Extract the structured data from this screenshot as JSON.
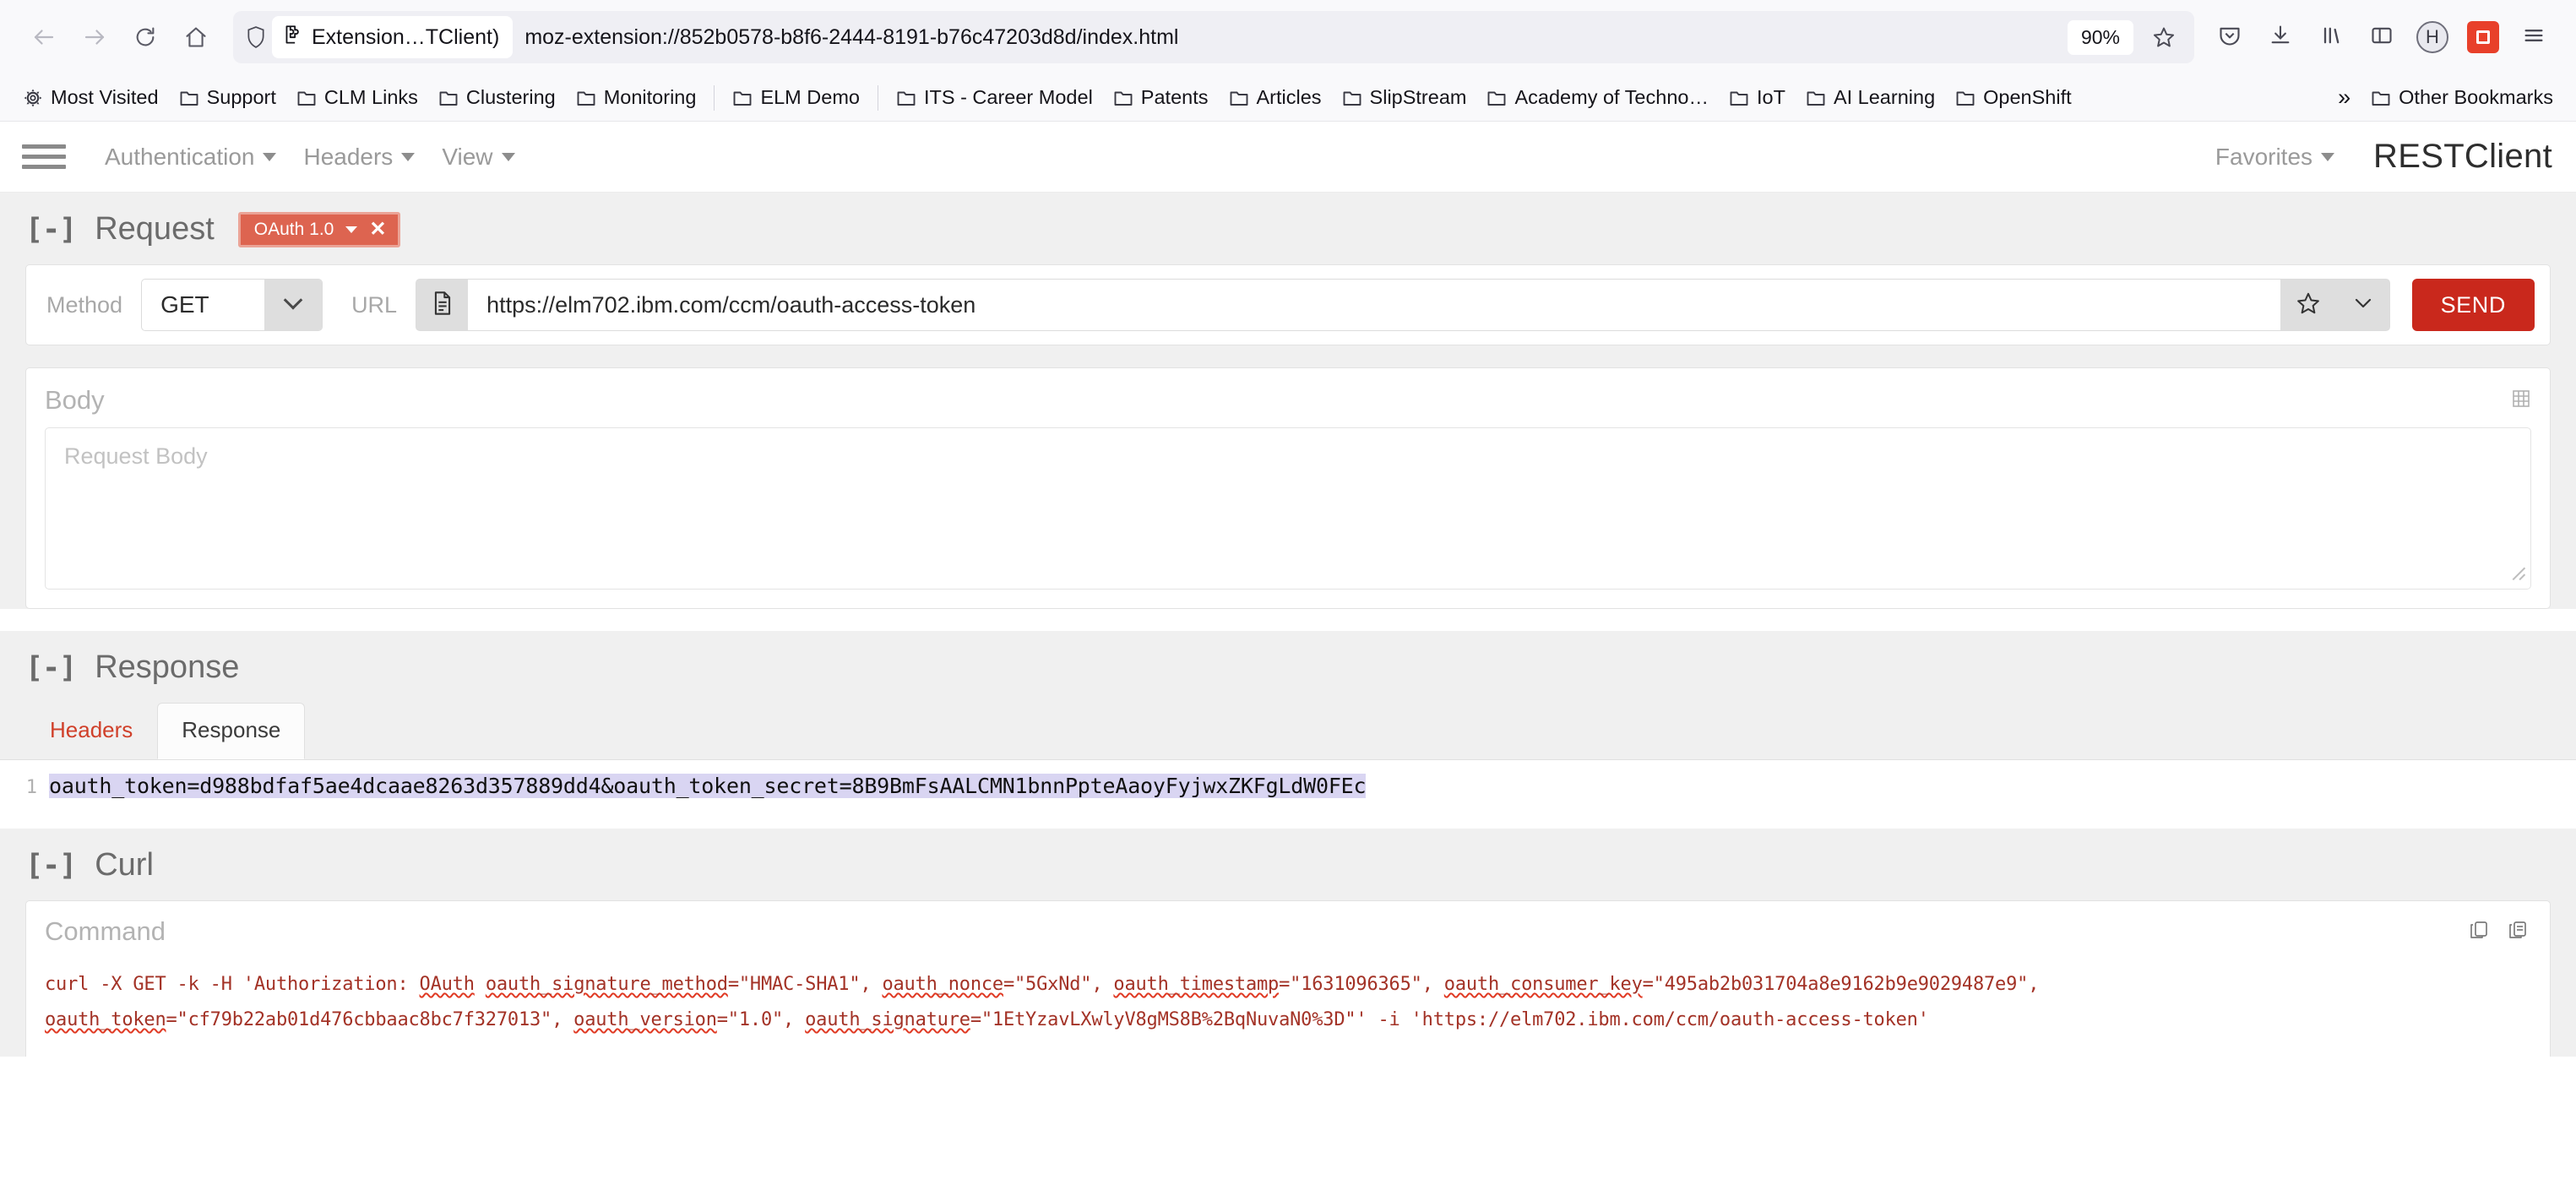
{
  "browser": {
    "nav": {
      "back": "back-arrow",
      "forward": "forward-arrow",
      "reload": "reload",
      "home": "home"
    },
    "urlbar": {
      "shield_icon": "shield-icon",
      "extension_chip_label": "Extension…TClient)",
      "url": "moz-extension://852b0578-b8f6-2444-8191-b76c47203d8d/index.html",
      "zoom": "90%",
      "bookmark_star": "star-icon"
    },
    "toolbar_right": [
      "pocket-icon",
      "downloads-icon",
      "library-icon",
      "sidebar-icon",
      "account-icon",
      "restclient-extension-icon",
      "app-menu-icon"
    ],
    "bookmarks": [
      {
        "label": "Most Visited",
        "icon": "gear-icon"
      },
      {
        "label": "Support",
        "icon": "folder-icon"
      },
      {
        "label": "CLM Links",
        "icon": "folder-icon"
      },
      {
        "label": "Clustering",
        "icon": "folder-icon"
      },
      {
        "label": "Monitoring",
        "icon": "folder-icon"
      },
      {
        "label": "ELM Demo",
        "icon": "folder-icon"
      },
      {
        "label": "ITS - Career Model",
        "icon": "folder-icon"
      },
      {
        "label": "Patents",
        "icon": "folder-icon"
      },
      {
        "label": "Articles",
        "icon": "folder-icon"
      },
      {
        "label": "SlipStream",
        "icon": "folder-icon"
      },
      {
        "label": "Academy of Techno…",
        "icon": "folder-icon"
      },
      {
        "label": "IoT",
        "icon": "folder-icon"
      },
      {
        "label": "AI Learning",
        "icon": "folder-icon"
      },
      {
        "label": "OpenShift",
        "icon": "folder-icon"
      }
    ],
    "bookmarks_overflow": "»",
    "other_bookmarks": "Other Bookmarks"
  },
  "app": {
    "menu": [
      {
        "label": "Authentication"
      },
      {
        "label": "Headers"
      },
      {
        "label": "View"
      }
    ],
    "favorites_label": "Favorites",
    "brand": "RESTClient"
  },
  "request": {
    "toggle": "[-]",
    "title": "Request",
    "auth_badge": {
      "label": "OAuth 1.0",
      "close": "✕"
    },
    "method_label": "Method",
    "method_value": "GET",
    "url_label": "URL",
    "url_value": "https://elm702.ibm.com/ccm/oauth-access-token",
    "send_label": "SEND",
    "body_label": "Body",
    "body_placeholder": "Request Body"
  },
  "response": {
    "toggle": "[-]",
    "title": "Response",
    "tabs": [
      {
        "label": "Headers",
        "active": false
      },
      {
        "label": "Response",
        "active": true
      }
    ],
    "line_number": "1",
    "content": "oauth_token=d988bdfaf5ae4dcaae8263d357889dd4&oauth_token_secret=8B9BmFsAALCMN1bnnPpteAaoyFyjwxZKFgLdW0FEc"
  },
  "curl": {
    "toggle": "[-]",
    "title": "Curl",
    "command_label": "Command",
    "command": "curl -X GET -k -H 'Authorization: OAuth oauth_signature_method=\"HMAC-SHA1\", oauth_nonce=\"5GxNd\", oauth_timestamp=\"1631096365\", oauth_consumer_key=\"495ab2b031704a8e9162b9e9029487e9\", oauth_token=\"cf79b22ab01d476cbbaac8bc7f327013\", oauth_version=\"1.0\", oauth_signature=\"1EtYzavLXwlyV8gMS8B%2BqNuvaN0%3D\"' -i 'https://elm702.ibm.com/ccm/oauth-access-token'",
    "copy_icon": "copy-icon",
    "copy_all_icon": "copy-all-icon"
  },
  "colors": {
    "send_red": "#c9281c",
    "badge_red": "#dd6450",
    "tab_link_red": "#d0402a",
    "selection_lilac": "#d9d5f2",
    "curl_text": "#a33226"
  }
}
